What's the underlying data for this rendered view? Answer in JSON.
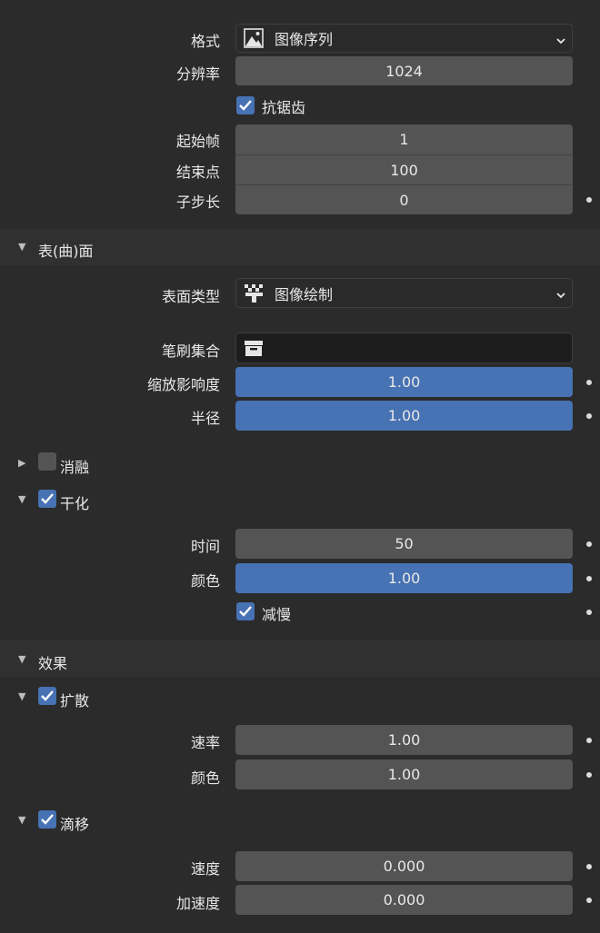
{
  "settings": {
    "format_label": "格式",
    "format_value": "图像序列",
    "resolution_label": "分辨率",
    "resolution_value": "1024",
    "antialias_label": "抗锯齿",
    "antialias_checked": true,
    "start_frame_label": "起始帧",
    "start_frame_value": "1",
    "end_point_label": "结束点",
    "end_point_value": "100",
    "substeps_label": "子步长",
    "substeps_value": "0"
  },
  "surface": {
    "header": "表(曲)面",
    "surface_type_label": "表面类型",
    "surface_type_value": "图像绘制",
    "brush_collection_label": "笔刷集合",
    "brush_collection_value": "",
    "scale_influence_label": "缩放影响度",
    "scale_influence_value": "1.00",
    "radius_label": "半径",
    "radius_value": "1.00"
  },
  "dissolve": {
    "header": "消融",
    "enabled": false
  },
  "dry": {
    "header": "干化",
    "enabled": true,
    "time_label": "时间",
    "time_value": "50",
    "color_label": "颜色",
    "color_value": "1.00",
    "slow_label": "减慢",
    "slow_checked": true
  },
  "effects": {
    "header": "效果"
  },
  "spread": {
    "header": "扩散",
    "enabled": true,
    "rate_label": "速率",
    "rate_value": "1.00",
    "color_label": "颜色",
    "color_value": "1.00"
  },
  "drip": {
    "header": "滴移",
    "enabled": true,
    "velocity_label": "速度",
    "velocity_value": "0.000",
    "acceleration_label": "加速度",
    "acceleration_value": "0.000"
  },
  "colors": {
    "background": "#2b2b2b",
    "field": "#545454",
    "accent": "#4772b3",
    "panel_header": "#303030"
  }
}
